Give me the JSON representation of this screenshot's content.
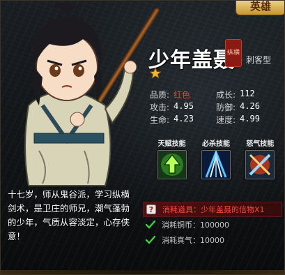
{
  "corner_badge": "英雄",
  "hero": {
    "name": "少年盖聂",
    "seal_text": "纵横",
    "class_tag": "刺客型",
    "stars": 1
  },
  "stats": [
    [
      {
        "label": "品质:",
        "value": "红色",
        "highlight": true
      },
      {
        "label": "成长:",
        "value": "112"
      }
    ],
    [
      {
        "label": "攻击:",
        "value": "4.95"
      },
      {
        "label": "防御:",
        "value": "4.26"
      }
    ],
    [
      {
        "label": "生命:",
        "value": "4.23"
      },
      {
        "label": "速度:",
        "value": "4.99"
      }
    ]
  ],
  "skills": [
    {
      "label": "天赋技能",
      "icon": "green-arrow-icon"
    },
    {
      "label": "必杀技能",
      "icon": "blue-sword-slash-icon"
    },
    {
      "label": "怒气技能",
      "icon": "red-cross-swords-icon"
    }
  ],
  "description": "十七岁，师从鬼谷派，学习纵横剑术，是卫庄的师兄，潮气蓬勃的少年，气质从容淡定，心存侠意！",
  "requirements": [
    {
      "icon": "question-icon",
      "text": "消耗道具：少年盖聂的信物X1",
      "status": "missing"
    },
    {
      "icon": "check-icon",
      "text": "消耗铜币：100000",
      "status": "ok"
    },
    {
      "icon": "check-icon",
      "text": "消耗真气：10000",
      "status": "ok"
    }
  ],
  "colors": {
    "accent_red": "#ff3b2f",
    "check_green": "#3fd13f",
    "gold": "#f0b830"
  }
}
